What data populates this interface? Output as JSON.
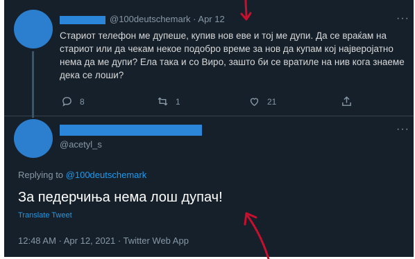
{
  "tweet1": {
    "handle": "@100deutschemark",
    "date": "Apr 12",
    "more": "···",
    "text": "Стариот телефон ме дупеше, купив нов еве и тој ме дупи. Да се враќам на стариот или да чекам некое подобро време за нов да купам кој најверојатно нема да ме дупи? Ела така и со Вирo, зашто би се вратиле на нив кога знаеме дека се лоши?",
    "replies": "8",
    "retweets": "1",
    "likes": "21"
  },
  "tweet2": {
    "handle": "@acetyl_s",
    "more": "···",
    "replying_label": "Replying to",
    "replying_handle": "@100deutschemark",
    "text": "За педерчиња нема лош дупач!",
    "translate": "Translate Tweet",
    "timestamp": "12:48 AM · Apr 12, 2021 · Twitter Web App"
  },
  "colors": {
    "background": "#15202b",
    "secondary_text": "#8899a6",
    "link": "#1d9bf0",
    "redaction": "#2b86d9",
    "annotation_arrow": "#c8102e"
  }
}
